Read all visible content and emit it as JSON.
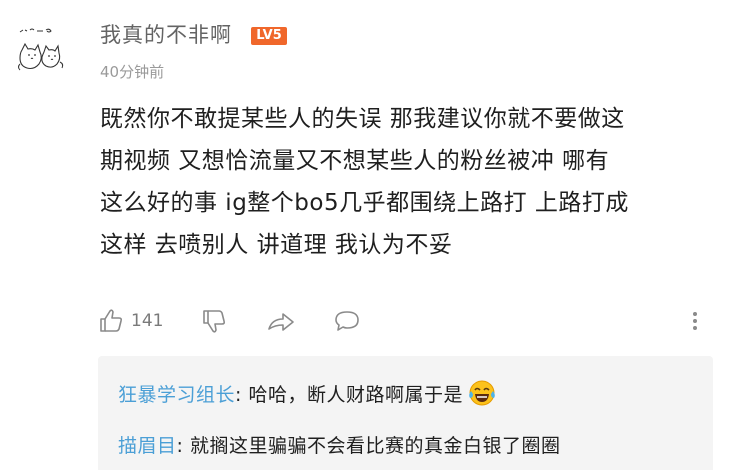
{
  "comment": {
    "username": "我真的不非啊",
    "level": "LV5",
    "time": "40分钟前",
    "lines": [
      "既然你不敢提某些人的失误  那我建议你就不要做这",
      "期视频  又想恰流量又不想某些人的粉丝被冲  哪有",
      "这么好的事  ig整个bo5几乎都围绕上路打  上路打成",
      "这样  去喷别人  讲道理  我认为不妥"
    ],
    "like_count": "141"
  },
  "icons": {
    "avatar": "cat-doodle-avatar",
    "like": "thumbs-up-icon",
    "dislike": "thumbs-down-icon",
    "share": "share-arrow-icon",
    "reply": "chat-bubble-icon",
    "more": "more-vertical-icon",
    "emoji": "laughing-tears-emoji"
  },
  "colors": {
    "level_badge": "#f0672b",
    "reply_author": "#4b9fd6",
    "reply_bg": "#f4f4f4"
  },
  "replies": [
    {
      "author": "狂暴学习组长",
      "separator": ": ",
      "text": "哈哈，断人财路啊属于是"
    },
    {
      "author": "描眉目",
      "separator": ": ",
      "text": "就搁这里骗骗不会看比赛的真金白银了圈圈"
    }
  ]
}
